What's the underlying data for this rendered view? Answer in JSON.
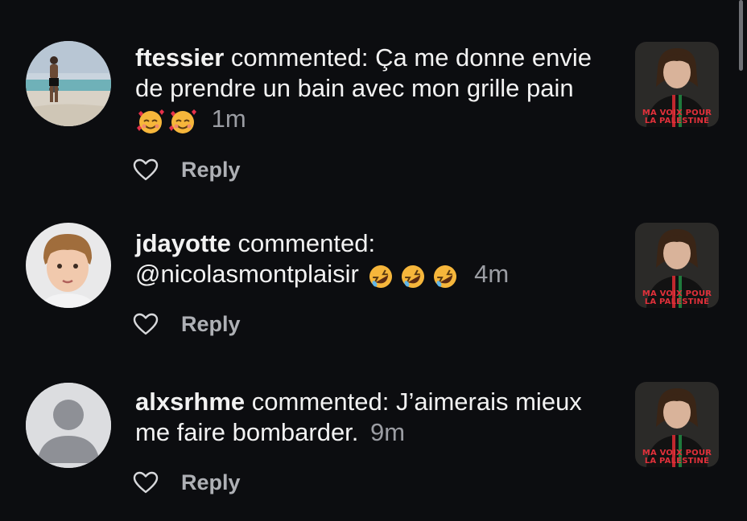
{
  "comments": [
    {
      "username": "ftessier",
      "verb": "commented:",
      "text": "Ça me donne envie de prendre un bain avec mon grille pain",
      "emojis": [
        "smiling-face-with-hearts",
        "smiling-face-with-hearts"
      ],
      "time": "1m",
      "reply_label": "Reply",
      "avatar_icon": "beach-photo-avatar",
      "thumbnail_caption_line1": "MA VOIX POUR",
      "thumbnail_caption_line2": "LA PALESTINE"
    },
    {
      "username": "jdayotte",
      "verb": "commented:",
      "text": "@nicolasmontplaisir",
      "emojis": [
        "rolling-on-floor-laughing",
        "rolling-on-floor-laughing",
        "rolling-on-floor-laughing"
      ],
      "time": "4m",
      "reply_label": "Reply",
      "avatar_icon": "child-photo-avatar",
      "thumbnail_caption_line1": "MA VOIX POUR",
      "thumbnail_caption_line2": "LA PALESTINE"
    },
    {
      "username": "alxsrhme",
      "verb": "commented:",
      "text": "J’aimerais mieux me faire bombarder.",
      "emojis": [],
      "time": "9m",
      "reply_label": "Reply",
      "avatar_icon": "default-user-avatar",
      "thumbnail_caption_line1": "MA VOIX POUR",
      "thumbnail_caption_line2": "LA PALESTINE"
    }
  ],
  "colors": {
    "background": "#0c0d10",
    "text": "#f2f2f2",
    "muted": "#9b9da3",
    "caption_red": "#e0303a"
  }
}
